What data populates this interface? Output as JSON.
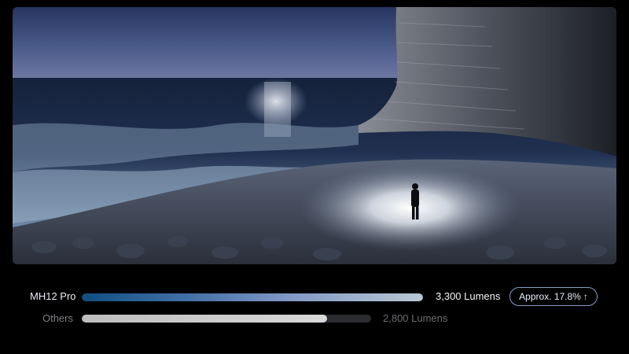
{
  "comparison": {
    "rows": [
      {
        "label": "MH12 Pro",
        "value": "3,300 Lumens",
        "relative_level": 1.0
      },
      {
        "label": "Others",
        "value": "2,800 Lumens",
        "relative_level": 0.848
      }
    ],
    "badge": {
      "text": "Approx. 17.8%",
      "icon": "arrow-up-icon"
    }
  },
  "colors": {
    "background": "#000000",
    "primary_bar_start": "#0f4f82",
    "primary_bar_end": "#b9c8d2",
    "secondary_bar": "#d0d0d0",
    "badge_border": "#7fa0c8"
  }
}
